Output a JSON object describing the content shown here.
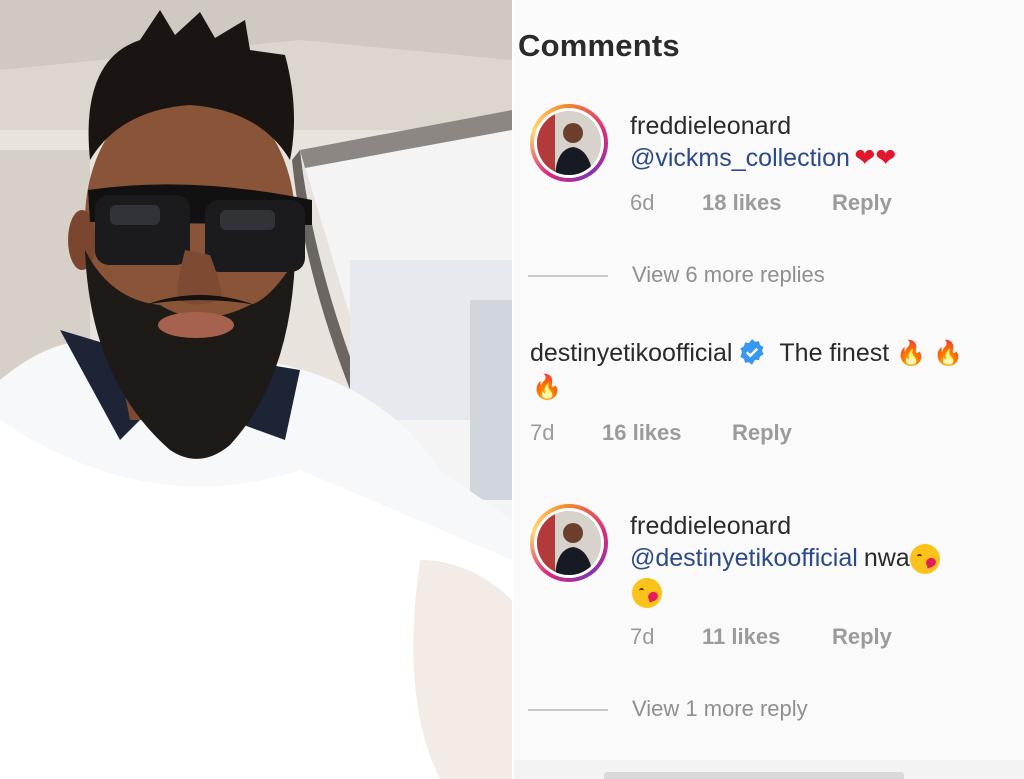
{
  "header": {
    "title": "Comments"
  },
  "comments": [
    {
      "username": "freddieleonard",
      "mention": "@vickms_collection",
      "emoji": [
        "heart",
        "heart"
      ],
      "time": "6d",
      "likes": "18 likes",
      "reply": "Reply",
      "view_more": "View 6 more replies"
    },
    {
      "username": "destinyetikoofficial",
      "verified": true,
      "text": "The finest",
      "emoji": [
        "fire",
        "fire",
        "fire"
      ],
      "time": "7d",
      "likes": "16 likes",
      "reply": "Reply"
    },
    {
      "username": "freddieleonard",
      "mention": "@destinyetikoofficial",
      "text": "nwa",
      "emoji": [
        "kiss",
        "kiss"
      ],
      "time": "7d",
      "likes": "11 likes",
      "reply": "Reply",
      "view_more": "View 1 more reply"
    }
  ],
  "colors": {
    "mention": "#2c4a8a",
    "verified": "#3897f0",
    "heart": "#e1172b",
    "meta": "#9a9a9a"
  }
}
